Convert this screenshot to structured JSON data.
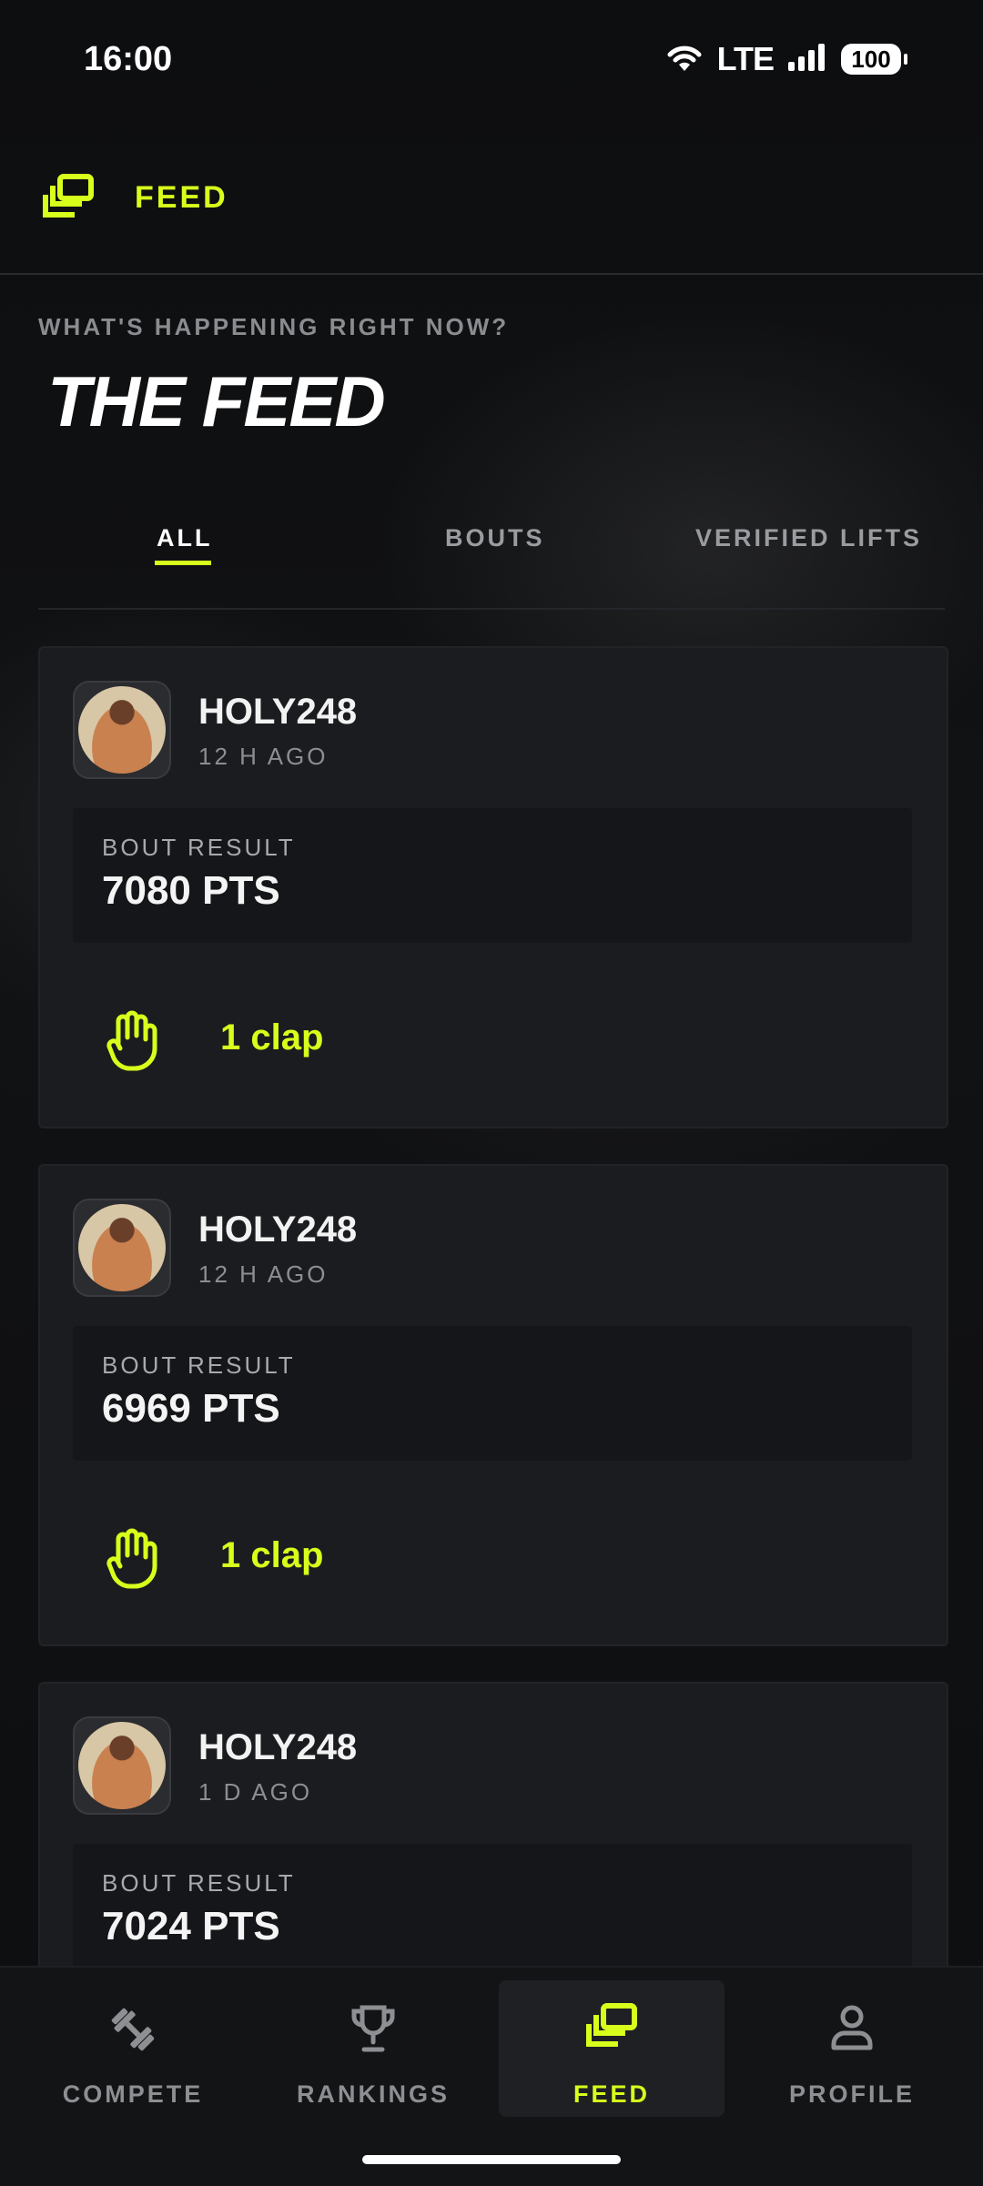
{
  "status_bar": {
    "time": "16:00",
    "network": "LTE",
    "battery": "100"
  },
  "header": {
    "title": "FEED",
    "icon": "feed-stack-icon"
  },
  "page": {
    "subtitle": "WHAT'S HAPPENING RIGHT NOW?",
    "title": "THE FEED"
  },
  "tabs": [
    {
      "label": "ALL",
      "active": true
    },
    {
      "label": "BOUTS",
      "active": false
    },
    {
      "label": "VERIFIED LIFTS",
      "active": false
    }
  ],
  "feed": [
    {
      "username": "HOLY248",
      "time_ago": "12 H AGO",
      "result_label": "BOUT RESULT",
      "result_value": "7080 PTS",
      "claps": "1 clap"
    },
    {
      "username": "HOLY248",
      "time_ago": "12 H AGO",
      "result_label": "BOUT RESULT",
      "result_value": "6969 PTS",
      "claps": "1 clap"
    },
    {
      "username": "HOLY248",
      "time_ago": "1 D AGO",
      "result_label": "BOUT RESULT",
      "result_value": "7024 PTS"
    }
  ],
  "bottom_nav": [
    {
      "label": "COMPETE",
      "icon": "dumbbell-icon",
      "active": false
    },
    {
      "label": "RANKINGS",
      "icon": "trophy-icon",
      "active": false
    },
    {
      "label": "FEED",
      "icon": "feed-stack-icon",
      "active": true
    },
    {
      "label": "PROFILE",
      "icon": "person-icon",
      "active": false
    }
  ],
  "colors": {
    "accent": "#d8ff1c",
    "background": "#0d0e10",
    "card": "#1b1c1f"
  }
}
